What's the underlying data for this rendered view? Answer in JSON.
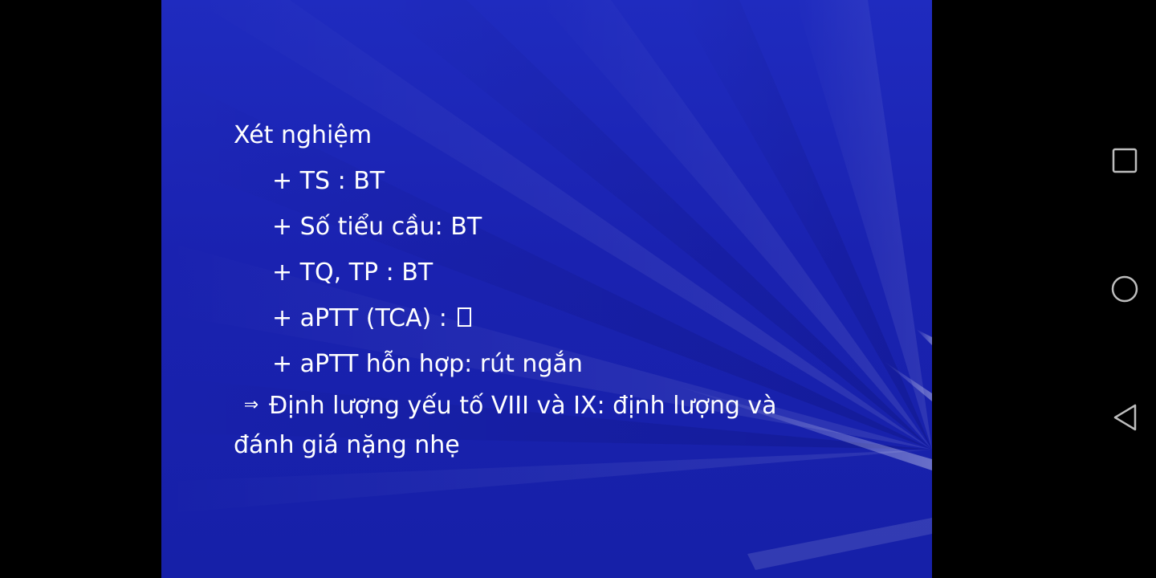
{
  "slide": {
    "background_color": "#1a22b0",
    "heading": "Xét nghiệm",
    "items": [
      "+ TS : BT",
      "+ Số tiểu cầu: BT",
      "+ TQ, TP : BT",
      "+ aPTT (TCA) :",
      "+ aPTT hỗn hợp: rút ngắn"
    ],
    "missing_glyph_icon": "missing-character-box",
    "conclusion_arrow": "⇒",
    "conclusion": "Định lượng yếu tố VIII và IX: định lượng và đánh giá nặng nhẹ"
  },
  "navbar": {
    "recents_icon": "square-icon",
    "home_icon": "circle-icon",
    "back_icon": "triangle-back-icon",
    "icon_color": "#bdbdbd"
  }
}
